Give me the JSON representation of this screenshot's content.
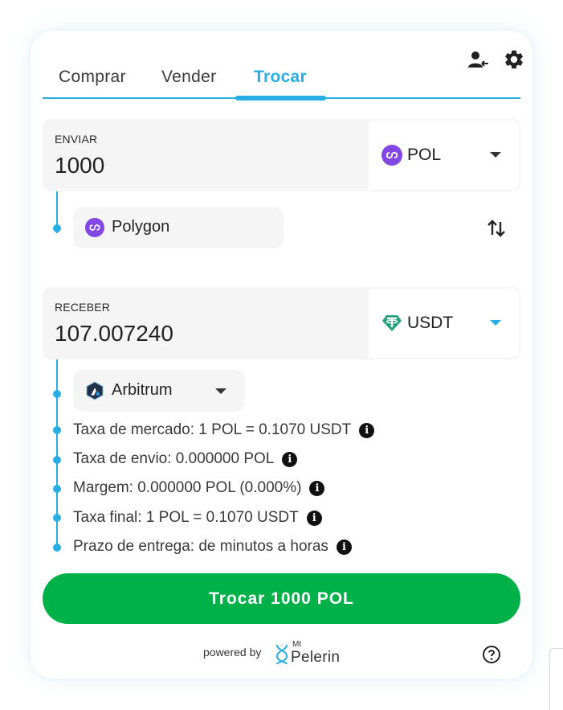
{
  "tabs": [
    {
      "label": "Comprar",
      "active": false
    },
    {
      "label": "Vender",
      "active": false
    },
    {
      "label": "Trocar",
      "active": true
    }
  ],
  "header_icons": [
    "user-switch-icon",
    "gear-icon"
  ],
  "send": {
    "label": "ENVIAR",
    "amount": "1000",
    "asset": "POL",
    "asset_icon": "polygon-icon",
    "network": "Polygon",
    "network_icon": "polygon-icon"
  },
  "receive": {
    "label": "RECEBER",
    "amount": "107.007240",
    "asset": "USDT",
    "asset_icon": "tether-icon",
    "network": "Arbitrum",
    "network_icon": "arbitrum-icon"
  },
  "info": [
    "Taxa de mercado: 1 POL = 0.1070 USDT",
    "Taxa de envio: 0.000000 POL",
    "Margem: 0.000000 POL (0.000%)",
    "Taxa final: 1 POL = 0.1070 USDT",
    "Prazo de entrega: de minutos a horas"
  ],
  "cta_label": "Trocar 1000 POL",
  "footer": {
    "powered_by": "powered by",
    "brand_prefix": "Mt",
    "brand_name": "Pelerin"
  },
  "colors": {
    "accent": "#27aee4",
    "cta": "#00b14a",
    "polygon": "#8247e5",
    "tether": "#26a17b"
  }
}
